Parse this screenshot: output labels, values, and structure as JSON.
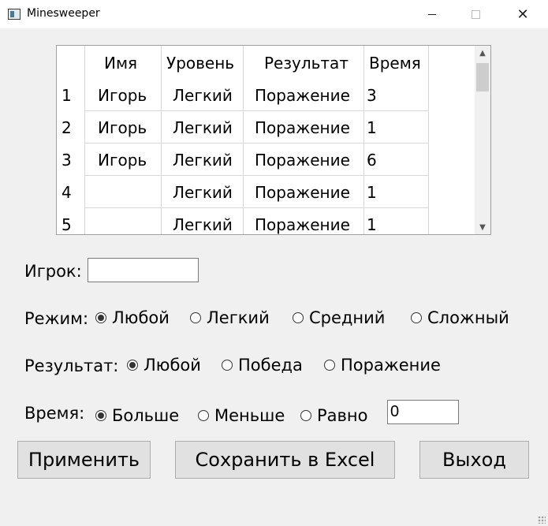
{
  "window": {
    "title": "Minesweeper",
    "minimize_icon": "minimize-icon",
    "maximize_icon": "maximize-icon",
    "close_icon": "close-icon",
    "close_glyph": "✕"
  },
  "table": {
    "headers": [
      "Имя",
      "Уровень",
      "Результат",
      "Время"
    ],
    "rows": [
      {
        "num": "1",
        "name": "Игорь",
        "level": "Легкий",
        "result": "Поражение",
        "time": "3"
      },
      {
        "num": "2",
        "name": "Игорь",
        "level": "Легкий",
        "result": "Поражение",
        "time": "1"
      },
      {
        "num": "3",
        "name": "Игорь",
        "level": "Легкий",
        "result": "Поражение",
        "time": "6"
      },
      {
        "num": "4",
        "name": "",
        "level": "Легкий",
        "result": "Поражение",
        "time": "1"
      },
      {
        "num": "5",
        "name": "",
        "level": "Легкий",
        "result": "Поражение",
        "time": "1"
      }
    ]
  },
  "filters": {
    "player_label": "Игрок:",
    "player_value": "",
    "mode_label": "Режим:",
    "mode_options": [
      "Любой",
      "Легкий",
      "Средний",
      "Сложный"
    ],
    "mode_selected": "Любой",
    "result_label": "Результат:",
    "result_options": [
      "Любой",
      "Победа",
      "Поражение"
    ],
    "result_selected": "Любой",
    "time_label": "Время:",
    "time_options": [
      "Больше",
      "Меньше",
      "Равно"
    ],
    "time_selected": "Больше",
    "time_value": "0"
  },
  "buttons": {
    "apply": "Применить",
    "save_excel": "Сохранить в Excel",
    "exit": "Выход"
  }
}
